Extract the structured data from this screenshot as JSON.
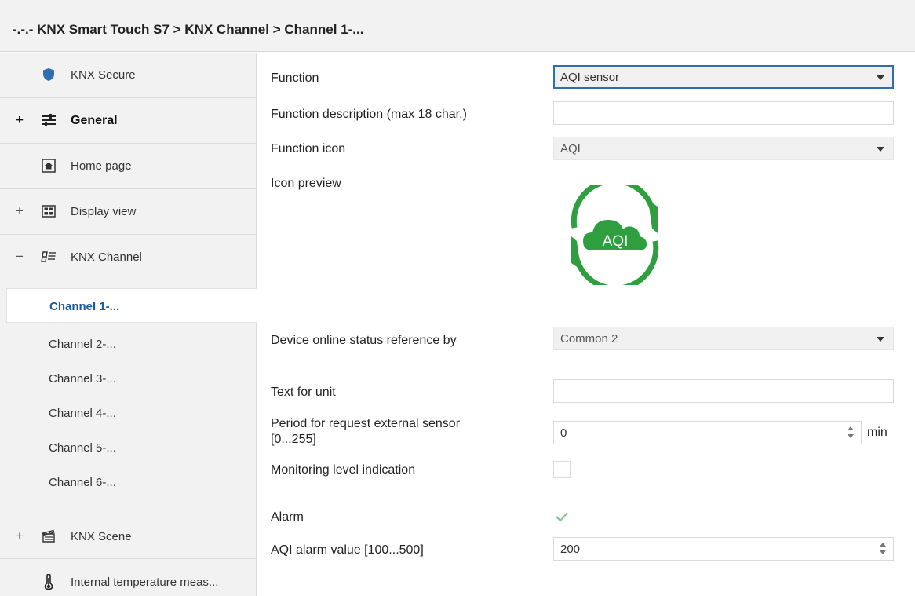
{
  "breadcrumb": "-.-.- KNX Smart Touch S7 > KNX Channel  > Channel 1-...",
  "sidebar": {
    "items": [
      {
        "sign": "",
        "label": "KNX Secure",
        "icon": "shield-icon"
      },
      {
        "sign": "+",
        "label": "General",
        "icon": "sliders-icon"
      },
      {
        "sign": "",
        "label": "Home page",
        "icon": "home-icon"
      },
      {
        "sign": "+",
        "label": "Display view",
        "icon": "display-grid-icon"
      },
      {
        "sign": "−",
        "label": "KNX Channel",
        "icon": "channel-icon"
      }
    ],
    "channels": [
      "Channel 1-...",
      "Channel 2-...",
      "Channel 3-...",
      "Channel 4-...",
      "Channel 5-...",
      "Channel 6-..."
    ],
    "bottom_items": [
      {
        "sign": "+",
        "label": "KNX Scene",
        "icon": "scene-clapper-icon"
      },
      {
        "sign": "",
        "label": "Internal temperature meas...",
        "icon": "thermometer-icon"
      }
    ]
  },
  "form": {
    "function_label": "Function",
    "function_value": "AQI sensor",
    "description_label": "Function description (max 18 char.)",
    "description_value": "",
    "icon_label": "Function icon",
    "icon_value": "AQI",
    "preview_label": "Icon preview",
    "preview_text": "AQI",
    "device_status_label": "Device online status reference by",
    "device_status_value": "Common 2",
    "unit_text_label": "Text for unit",
    "unit_text_value": "",
    "period_label_line1": "Period for request external sensor",
    "period_label_line2": "[0...255]",
    "period_value": "0",
    "period_unit": "min",
    "monitoring_label": "Monitoring level indication",
    "monitoring_checked": false,
    "alarm_label": "Alarm",
    "alarm_checked": true,
    "alarm_value_label": "AQI alarm value [100...500]",
    "alarm_value": "200"
  },
  "colors": {
    "accent": "#2f6fb1",
    "active_channel": "#1a5a9a",
    "aqi_green": "#2e9e3f"
  }
}
